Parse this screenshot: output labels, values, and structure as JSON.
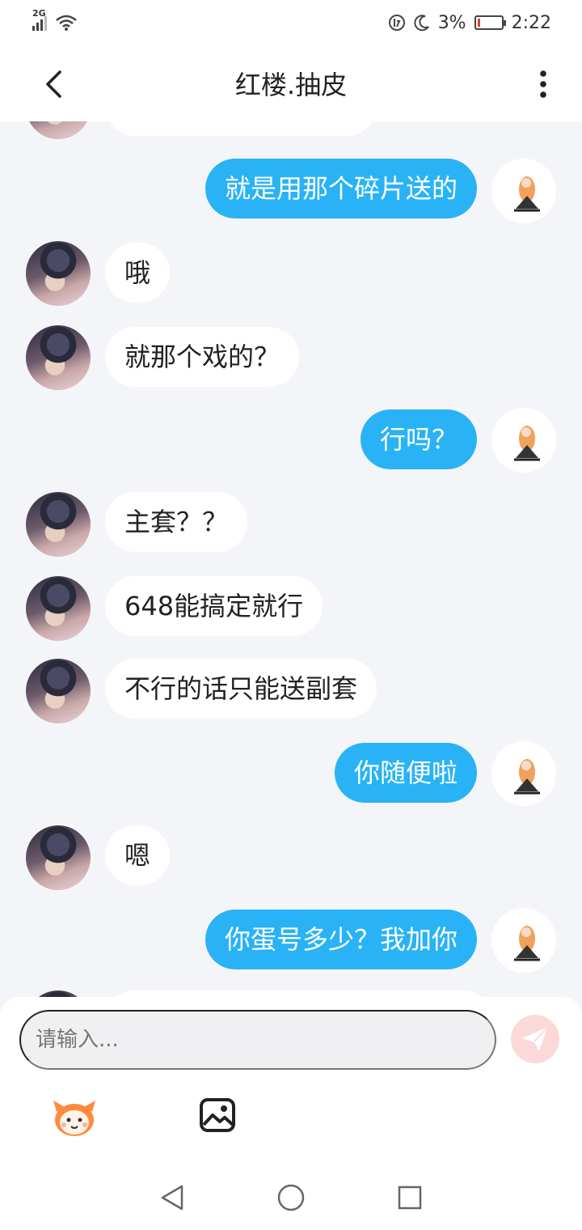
{
  "status_bar": {
    "network": "2G",
    "battery_percent": "3%",
    "time": "2:22"
  },
  "header": {
    "title": "红楼.抽皮",
    "back_icon": "chevron-left-icon",
    "more_icon": "more-vertical-icon"
  },
  "messages": [
    {
      "sender": "self",
      "text": "就是用那个碎片送的"
    },
    {
      "sender": "other",
      "text": "哦"
    },
    {
      "sender": "other",
      "text": "就那个戏的？"
    },
    {
      "sender": "self",
      "text": "行吗？"
    },
    {
      "sender": "other",
      "text": "主套？？"
    },
    {
      "sender": "other",
      "text": "648能搞定就行"
    },
    {
      "sender": "other",
      "text": "不行的话只能送副套"
    },
    {
      "sender": "self",
      "text": "你随便啦"
    },
    {
      "sender": "other",
      "text": "嗯"
    },
    {
      "sender": "self",
      "text": "你蛋号多少？我加你"
    }
  ],
  "composer": {
    "placeholder": "请输入...",
    "send_icon": "send-icon",
    "emoji_icon": "emoji-face-icon",
    "image_icon": "image-icon"
  },
  "colors": {
    "self_bubble": "#29b3f6",
    "other_bubble": "#ffffff",
    "background": "#f4f5f9",
    "send_button": "#fbd9d8"
  }
}
